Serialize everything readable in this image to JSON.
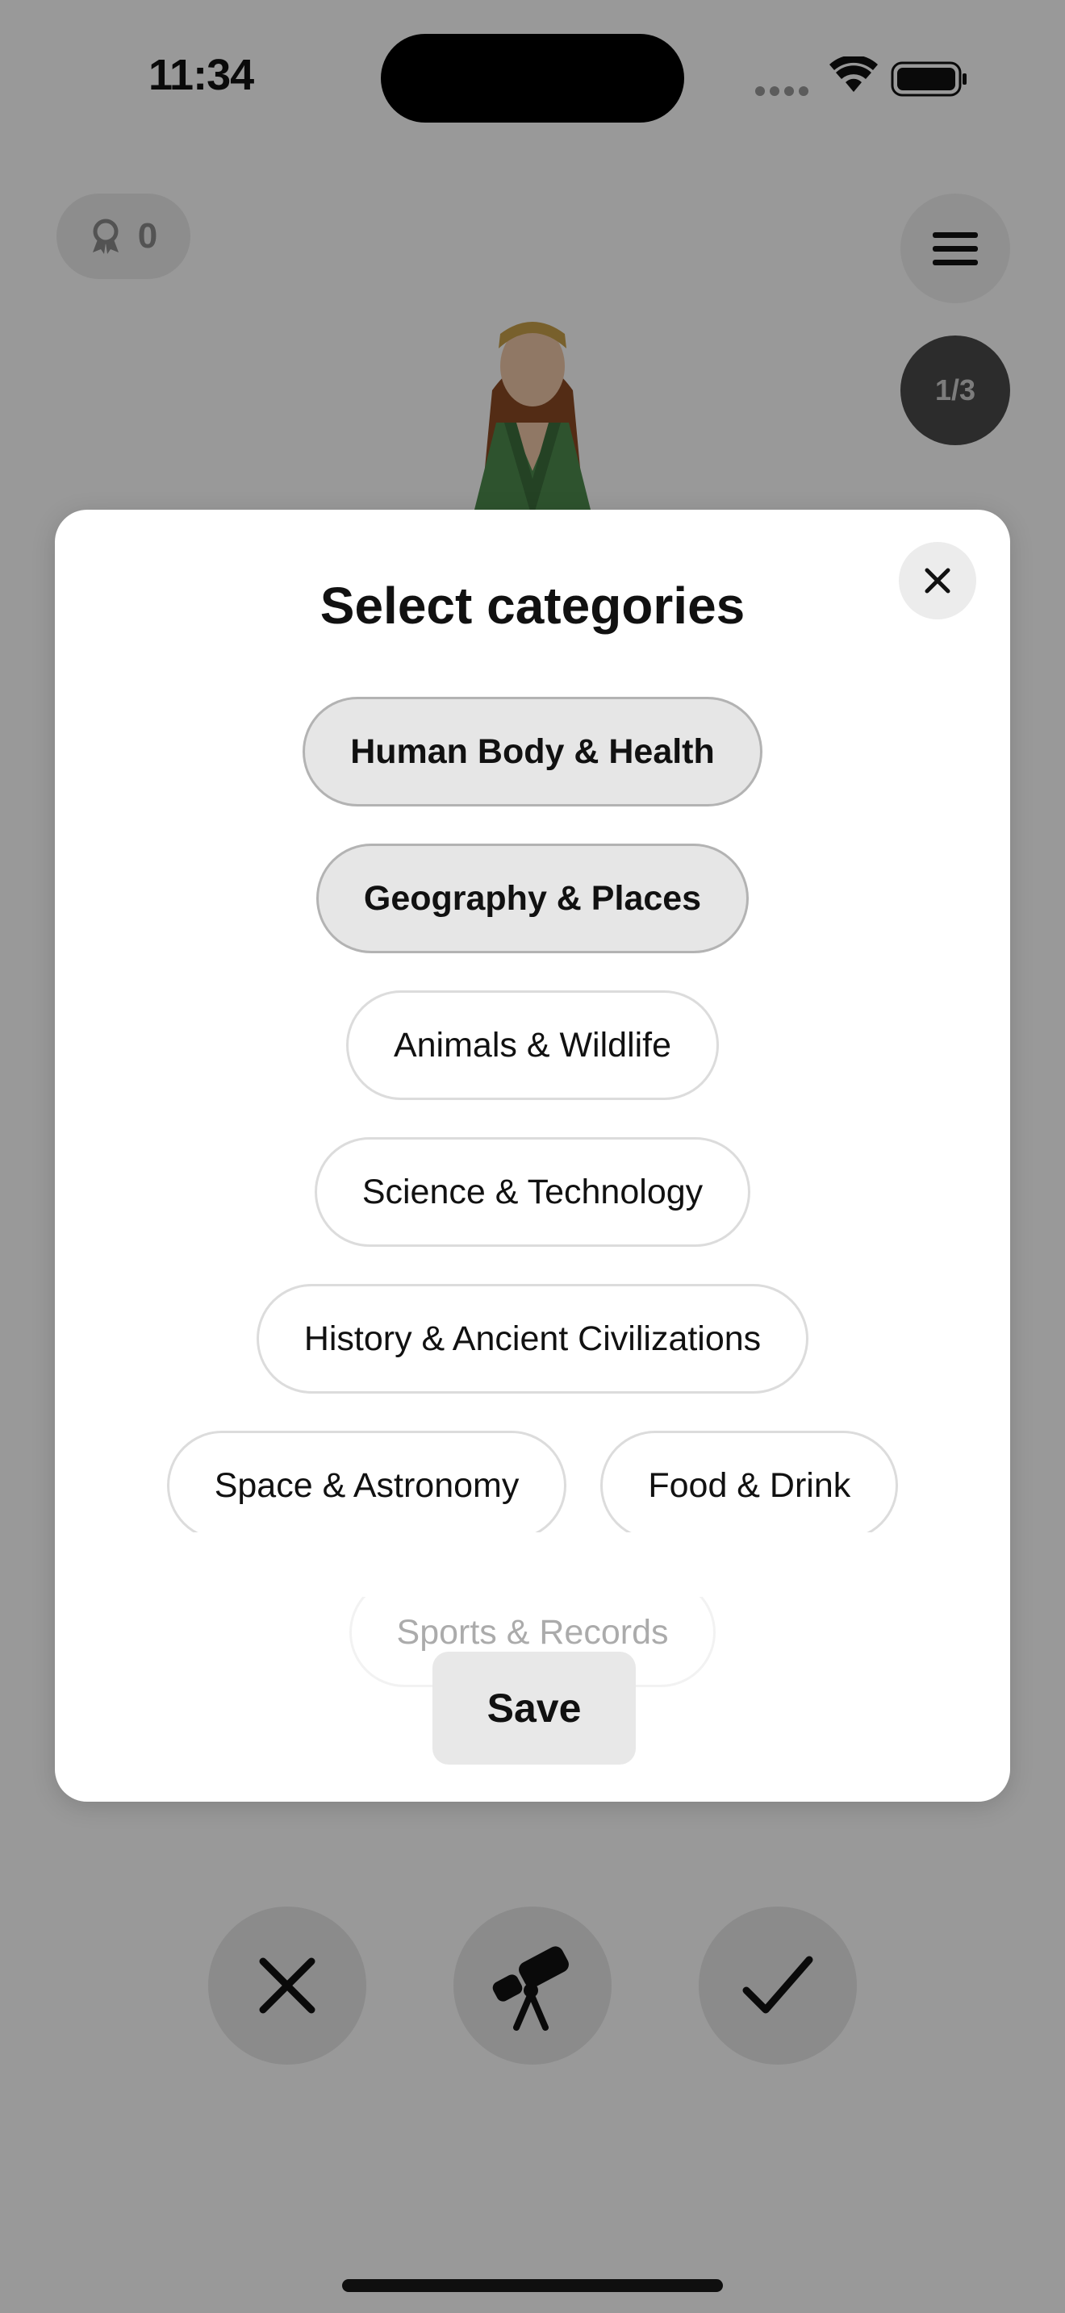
{
  "status_bar": {
    "time": "11:34"
  },
  "header": {
    "score": "0",
    "progress": "1/3"
  },
  "modal": {
    "title": "Select categories",
    "categories": [
      {
        "label": "Human Body & Health",
        "selected": true
      },
      {
        "label": "Geography & Places",
        "selected": true
      },
      {
        "label": "Animals & Wildlife",
        "selected": false
      },
      {
        "label": "Science & Technology",
        "selected": false
      },
      {
        "label": "History & Ancient Civilizations",
        "selected": false
      },
      {
        "label": "Space & Astronomy",
        "selected": false
      },
      {
        "label": "Food & Drink",
        "selected": false
      },
      {
        "label": "Sports & Records",
        "selected": false
      }
    ],
    "save_label": "Save"
  },
  "actions": [
    {
      "icon": "close-icon"
    },
    {
      "icon": "telescope-icon"
    },
    {
      "icon": "checkmark-icon"
    }
  ],
  "colors": {
    "overlay": "#000000",
    "modal_bg": "#ffffff",
    "chip_selected": "#e6e6e6"
  }
}
